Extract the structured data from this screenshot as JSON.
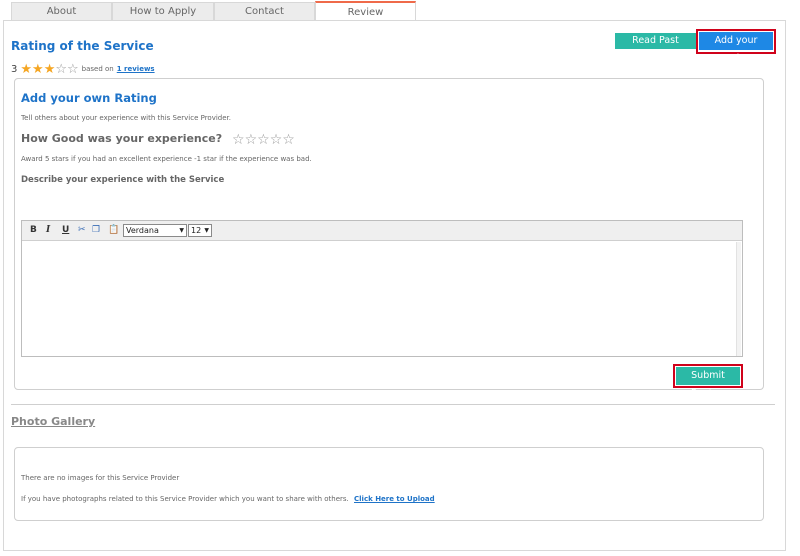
{
  "tabs": [
    {
      "label": "About",
      "active": false
    },
    {
      "label": "How to Apply",
      "active": false
    },
    {
      "label": "Contact",
      "active": false
    },
    {
      "label": "Review",
      "active": true
    }
  ],
  "rating": {
    "title": "Rating of the Service",
    "score": "3",
    "stars_filled": 3,
    "stars_total": 5,
    "based_on": "based on",
    "reviews_link": "1 reviews"
  },
  "actions": {
    "read_past_review": "Read Past Review",
    "add_your_rating": "Add your Rating"
  },
  "add_rating": {
    "title": "Add your own Rating",
    "intro": "Tell others about your experience with this Service Provider.",
    "question": "How Good was your experience?",
    "hint": "Award 5 stars if you had an excellent experience -1 star if the experience was bad.",
    "describe_label": "Describe your experience with the Service",
    "submit": "Submit Review"
  },
  "editor": {
    "font": "Verdana",
    "size": "12",
    "tools": [
      "B",
      "I",
      "U"
    ]
  },
  "gallery": {
    "title": "Photo Gallery",
    "no_images": "There are no images for this Service Provider",
    "share_text": "If you have photographs related to this Service Provider which you want to share with others.",
    "upload_link": "Click Here to Upload"
  },
  "colors": {
    "accent_blue": "#1e73c8",
    "teal": "#2bb9a6",
    "star_orange": "#f5a623",
    "highlight_red": "#d0021b"
  }
}
